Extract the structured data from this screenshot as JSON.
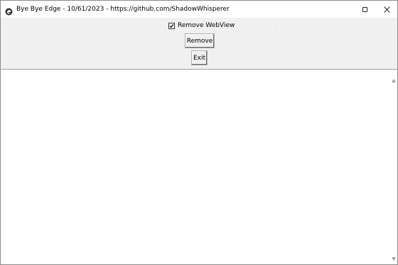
{
  "window": {
    "title": "Bye Bye Edge - 10/61/2023 - https://github.com/ShadowWhisperer"
  },
  "controls": {
    "checkbox_label": "Remove WebView",
    "checkbox_checked": true,
    "remove_label": "Remove",
    "exit_label": "Exit"
  },
  "icons": {
    "app": "edge-icon",
    "maximize": "maximize-icon",
    "close": "close-icon",
    "scroll_up": "scroll-up-arrow-icon",
    "scroll_down": "scroll-down-arrow-icon"
  },
  "colors": {
    "window_bg": "#f0f0f0",
    "content_bg": "#ffffff"
  }
}
